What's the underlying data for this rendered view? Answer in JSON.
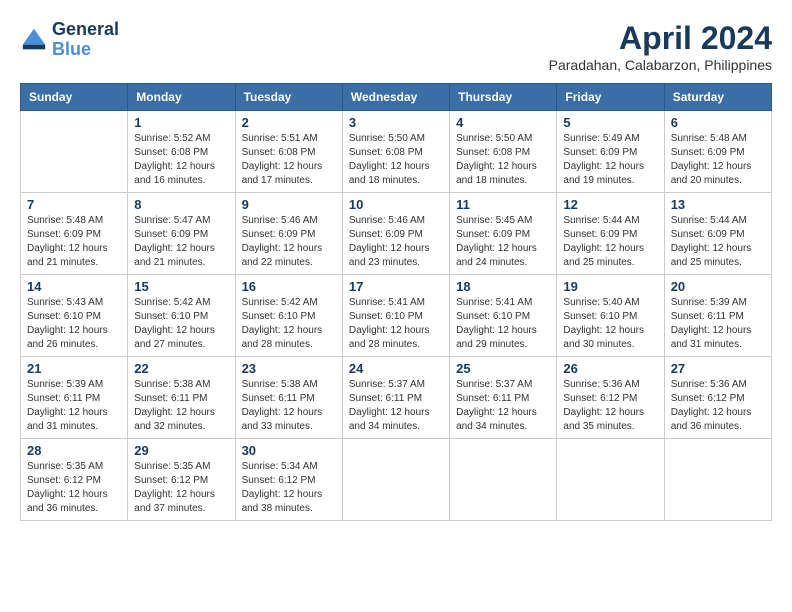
{
  "logo": {
    "line1": "General",
    "line2": "Blue"
  },
  "title": "April 2024",
  "subtitle": "Paradahan, Calabarzon, Philippines",
  "days_of_week": [
    "Sunday",
    "Monday",
    "Tuesday",
    "Wednesday",
    "Thursday",
    "Friday",
    "Saturday"
  ],
  "weeks": [
    [
      {
        "day": "",
        "sunrise": "",
        "sunset": "",
        "daylight": ""
      },
      {
        "day": "1",
        "sunrise": "Sunrise: 5:52 AM",
        "sunset": "Sunset: 6:08 PM",
        "daylight": "Daylight: 12 hours and 16 minutes."
      },
      {
        "day": "2",
        "sunrise": "Sunrise: 5:51 AM",
        "sunset": "Sunset: 6:08 PM",
        "daylight": "Daylight: 12 hours and 17 minutes."
      },
      {
        "day": "3",
        "sunrise": "Sunrise: 5:50 AM",
        "sunset": "Sunset: 6:08 PM",
        "daylight": "Daylight: 12 hours and 18 minutes."
      },
      {
        "day": "4",
        "sunrise": "Sunrise: 5:50 AM",
        "sunset": "Sunset: 6:08 PM",
        "daylight": "Daylight: 12 hours and 18 minutes."
      },
      {
        "day": "5",
        "sunrise": "Sunrise: 5:49 AM",
        "sunset": "Sunset: 6:09 PM",
        "daylight": "Daylight: 12 hours and 19 minutes."
      },
      {
        "day": "6",
        "sunrise": "Sunrise: 5:48 AM",
        "sunset": "Sunset: 6:09 PM",
        "daylight": "Daylight: 12 hours and 20 minutes."
      }
    ],
    [
      {
        "day": "7",
        "sunrise": "Sunrise: 5:48 AM",
        "sunset": "Sunset: 6:09 PM",
        "daylight": "Daylight: 12 hours and 21 minutes."
      },
      {
        "day": "8",
        "sunrise": "Sunrise: 5:47 AM",
        "sunset": "Sunset: 6:09 PM",
        "daylight": "Daylight: 12 hours and 21 minutes."
      },
      {
        "day": "9",
        "sunrise": "Sunrise: 5:46 AM",
        "sunset": "Sunset: 6:09 PM",
        "daylight": "Daylight: 12 hours and 22 minutes."
      },
      {
        "day": "10",
        "sunrise": "Sunrise: 5:46 AM",
        "sunset": "Sunset: 6:09 PM",
        "daylight": "Daylight: 12 hours and 23 minutes."
      },
      {
        "day": "11",
        "sunrise": "Sunrise: 5:45 AM",
        "sunset": "Sunset: 6:09 PM",
        "daylight": "Daylight: 12 hours and 24 minutes."
      },
      {
        "day": "12",
        "sunrise": "Sunrise: 5:44 AM",
        "sunset": "Sunset: 6:09 PM",
        "daylight": "Daylight: 12 hours and 25 minutes."
      },
      {
        "day": "13",
        "sunrise": "Sunrise: 5:44 AM",
        "sunset": "Sunset: 6:09 PM",
        "daylight": "Daylight: 12 hours and 25 minutes."
      }
    ],
    [
      {
        "day": "14",
        "sunrise": "Sunrise: 5:43 AM",
        "sunset": "Sunset: 6:10 PM",
        "daylight": "Daylight: 12 hours and 26 minutes."
      },
      {
        "day": "15",
        "sunrise": "Sunrise: 5:42 AM",
        "sunset": "Sunset: 6:10 PM",
        "daylight": "Daylight: 12 hours and 27 minutes."
      },
      {
        "day": "16",
        "sunrise": "Sunrise: 5:42 AM",
        "sunset": "Sunset: 6:10 PM",
        "daylight": "Daylight: 12 hours and 28 minutes."
      },
      {
        "day": "17",
        "sunrise": "Sunrise: 5:41 AM",
        "sunset": "Sunset: 6:10 PM",
        "daylight": "Daylight: 12 hours and 28 minutes."
      },
      {
        "day": "18",
        "sunrise": "Sunrise: 5:41 AM",
        "sunset": "Sunset: 6:10 PM",
        "daylight": "Daylight: 12 hours and 29 minutes."
      },
      {
        "day": "19",
        "sunrise": "Sunrise: 5:40 AM",
        "sunset": "Sunset: 6:10 PM",
        "daylight": "Daylight: 12 hours and 30 minutes."
      },
      {
        "day": "20",
        "sunrise": "Sunrise: 5:39 AM",
        "sunset": "Sunset: 6:11 PM",
        "daylight": "Daylight: 12 hours and 31 minutes."
      }
    ],
    [
      {
        "day": "21",
        "sunrise": "Sunrise: 5:39 AM",
        "sunset": "Sunset: 6:11 PM",
        "daylight": "Daylight: 12 hours and 31 minutes."
      },
      {
        "day": "22",
        "sunrise": "Sunrise: 5:38 AM",
        "sunset": "Sunset: 6:11 PM",
        "daylight": "Daylight: 12 hours and 32 minutes."
      },
      {
        "day": "23",
        "sunrise": "Sunrise: 5:38 AM",
        "sunset": "Sunset: 6:11 PM",
        "daylight": "Daylight: 12 hours and 33 minutes."
      },
      {
        "day": "24",
        "sunrise": "Sunrise: 5:37 AM",
        "sunset": "Sunset: 6:11 PM",
        "daylight": "Daylight: 12 hours and 34 minutes."
      },
      {
        "day": "25",
        "sunrise": "Sunrise: 5:37 AM",
        "sunset": "Sunset: 6:11 PM",
        "daylight": "Daylight: 12 hours and 34 minutes."
      },
      {
        "day": "26",
        "sunrise": "Sunrise: 5:36 AM",
        "sunset": "Sunset: 6:12 PM",
        "daylight": "Daylight: 12 hours and 35 minutes."
      },
      {
        "day": "27",
        "sunrise": "Sunrise: 5:36 AM",
        "sunset": "Sunset: 6:12 PM",
        "daylight": "Daylight: 12 hours and 36 minutes."
      }
    ],
    [
      {
        "day": "28",
        "sunrise": "Sunrise: 5:35 AM",
        "sunset": "Sunset: 6:12 PM",
        "daylight": "Daylight: 12 hours and 36 minutes."
      },
      {
        "day": "29",
        "sunrise": "Sunrise: 5:35 AM",
        "sunset": "Sunset: 6:12 PM",
        "daylight": "Daylight: 12 hours and 37 minutes."
      },
      {
        "day": "30",
        "sunrise": "Sunrise: 5:34 AM",
        "sunset": "Sunset: 6:12 PM",
        "daylight": "Daylight: 12 hours and 38 minutes."
      },
      {
        "day": "",
        "sunrise": "",
        "sunset": "",
        "daylight": ""
      },
      {
        "day": "",
        "sunrise": "",
        "sunset": "",
        "daylight": ""
      },
      {
        "day": "",
        "sunrise": "",
        "sunset": "",
        "daylight": ""
      },
      {
        "day": "",
        "sunrise": "",
        "sunset": "",
        "daylight": ""
      }
    ]
  ]
}
